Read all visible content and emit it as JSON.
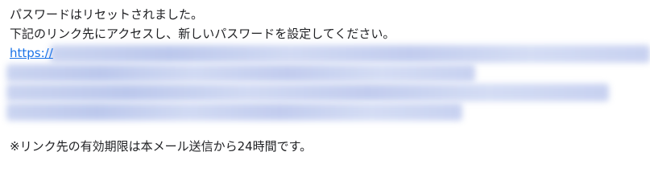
{
  "email": {
    "line1": "パスワードはリセットされました。",
    "line2": "下記のリンク先にアクセスし、新しいパスワードを設定してください。",
    "link_prefix": "https://",
    "note": "※リンク先の有効期限は本メール送信から24時間です。"
  },
  "colors": {
    "text": "#202124",
    "link": "#1a73e8",
    "redacted": "#c5cff0"
  }
}
